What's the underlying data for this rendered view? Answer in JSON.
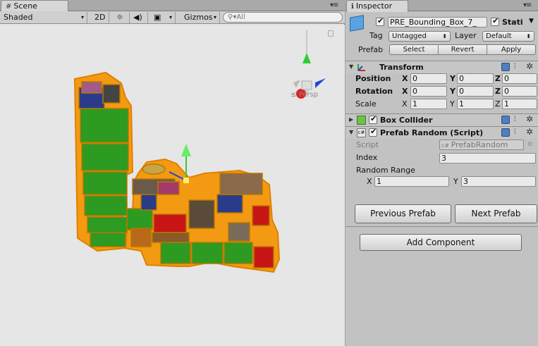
{
  "scene": {
    "tab_label": "Scene",
    "shading_mode": "Shaded",
    "mode_2d": "2D",
    "gizmos_label": "Gizmos",
    "search_placeholder": "All",
    "view_label": "Persp"
  },
  "inspector": {
    "tab_label": "Inspector",
    "object_name": "PRE_Bounding_Box_7_",
    "static_label": "Stati",
    "tag_label": "Tag",
    "tag_value": "Untagged",
    "layer_label": "Layer",
    "layer_value": "Default",
    "prefab_label": "Prefab",
    "prefab_buttons": [
      "Select",
      "Revert",
      "Apply"
    ],
    "transform": {
      "title": "Transform",
      "rows": [
        {
          "label": "Position",
          "x": "0",
          "y": "0",
          "z": "0"
        },
        {
          "label": "Rotation",
          "x": "0",
          "y": "0",
          "z": "0"
        },
        {
          "label": "Scale",
          "x": "1",
          "y": "1",
          "z": "1"
        }
      ],
      "axis_labels": [
        "X",
        "Y",
        "Z"
      ]
    },
    "box_collider": {
      "title": "Box Collider"
    },
    "prefab_random": {
      "title": "Prefab Random (Script)",
      "script_label": "Script",
      "script_value": "PrefabRandom",
      "index_label": "Index",
      "index_value": "3",
      "range_label": "Random Range",
      "range_x_label": "X",
      "range_x": "1",
      "range_y_label": "Y",
      "range_y": "3",
      "previous_button": "Previous Prefab",
      "next_button": "Next Prefab"
    },
    "add_component": "Add Component"
  },
  "colors": {
    "selection_outline": "#ff9900",
    "block_green": "#2d9a22",
    "block_red": "#c81616",
    "axis_x": "#e02020",
    "axis_y": "#33cc33",
    "axis_z": "#2244dd"
  }
}
